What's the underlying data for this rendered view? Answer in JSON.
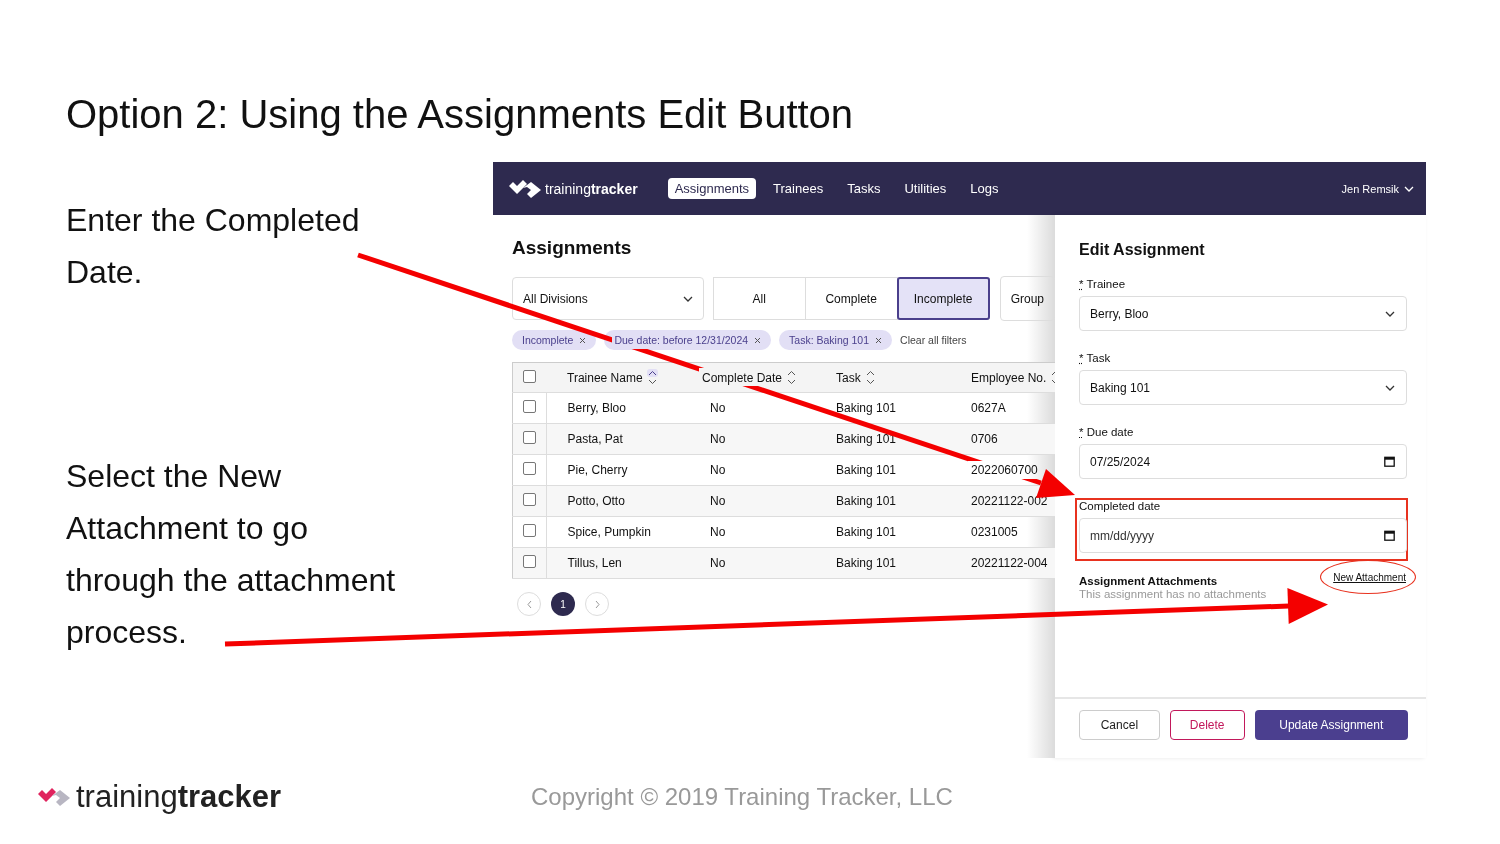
{
  "slide": {
    "title": "Option 2: Using the Assignments Edit Button",
    "notes": [
      "Enter the Completed Date.",
      "Select the New Attachment to go through the attachment process."
    ],
    "footer": {
      "logo": "training**tracker**",
      "copyright": "Copyright © 2019 Training Tracker, LLC"
    }
  },
  "app": {
    "nav": {
      "logo": "training**tracker**",
      "tabs": [
        {
          "label": "Assignments",
          "selected": true
        },
        {
          "label": "Trainees",
          "selected": false
        },
        {
          "label": "Tasks",
          "selected": false
        },
        {
          "label": "Utilities",
          "selected": false
        },
        {
          "label": "Logs",
          "selected": false
        }
      ],
      "user": "Jen Remsik"
    },
    "assignments": {
      "heading": "Assignments",
      "division_select": "All Divisions",
      "status_filters": [
        {
          "label": "All",
          "selected": false
        },
        {
          "label": "Complete",
          "selected": false
        },
        {
          "label": "Incomplete",
          "selected": true
        }
      ],
      "group_button": "Group",
      "chips": [
        {
          "label": "Incomplete"
        },
        {
          "label": "Due date: before 12/31/2024"
        },
        {
          "label": "Task: Baking 101"
        }
      ],
      "clear_filters": "Clear all filters",
      "table": {
        "select_all_checked": false,
        "columns": [
          {
            "label": "Trainee Name",
            "sorted": true
          },
          {
            "label": "Complete Date",
            "sorted": false
          },
          {
            "label": "Task",
            "sorted": false
          },
          {
            "label": "Employee No.",
            "sorted": false
          }
        ],
        "rows": [
          {
            "checked": false,
            "cells": [
              "Berry, Bloo",
              "No",
              "Baking 101",
              "0627A"
            ]
          },
          {
            "checked": false,
            "cells": [
              "Pasta, Pat",
              "No",
              "Baking 101",
              "0706"
            ]
          },
          {
            "checked": false,
            "cells": [
              "Pie, Cherry",
              "No",
              "Baking 101",
              "2022060700"
            ]
          },
          {
            "checked": false,
            "cells": [
              "Potto, Otto",
              "No",
              "Baking 101",
              "20221122-002"
            ]
          },
          {
            "checked": false,
            "cells": [
              "Spice, Pumpkin",
              "No",
              "Baking 101",
              "0231005"
            ]
          },
          {
            "checked": false,
            "cells": [
              "Tillus, Len",
              "No",
              "Baking 101",
              "20221122-004"
            ]
          }
        ]
      },
      "pagination": {
        "pages": [
          {
            "label": "1",
            "selected": true
          }
        ]
      }
    },
    "edit_panel": {
      "title": "Edit Assignment",
      "required_mark": "*",
      "fields": [
        {
          "label": "Trainee",
          "required": true,
          "kind": "select",
          "value": "Berry, Bloo",
          "highlighted": false
        },
        {
          "label": "Task",
          "required": true,
          "kind": "select",
          "value": "Baking 101",
          "highlighted": false
        },
        {
          "label": "Due date",
          "required": true,
          "kind": "date",
          "value": "07/25/2024",
          "highlighted": false
        },
        {
          "label": "Completed date",
          "required": false,
          "kind": "date",
          "placeholder": "mm/dd/yyyy",
          "highlighted": true
        }
      ],
      "attachments_title": "Assignment Attachments",
      "new_attachment": "New Attachment",
      "new_attachment_circled": true,
      "attachments_empty": "This assignment has no attachments",
      "buttons": [
        {
          "label": "Cancel",
          "kind": "secondary"
        },
        {
          "label": "Delete",
          "kind": "danger"
        },
        {
          "label": "Update Assignment",
          "kind": "primary"
        }
      ]
    }
  }
}
